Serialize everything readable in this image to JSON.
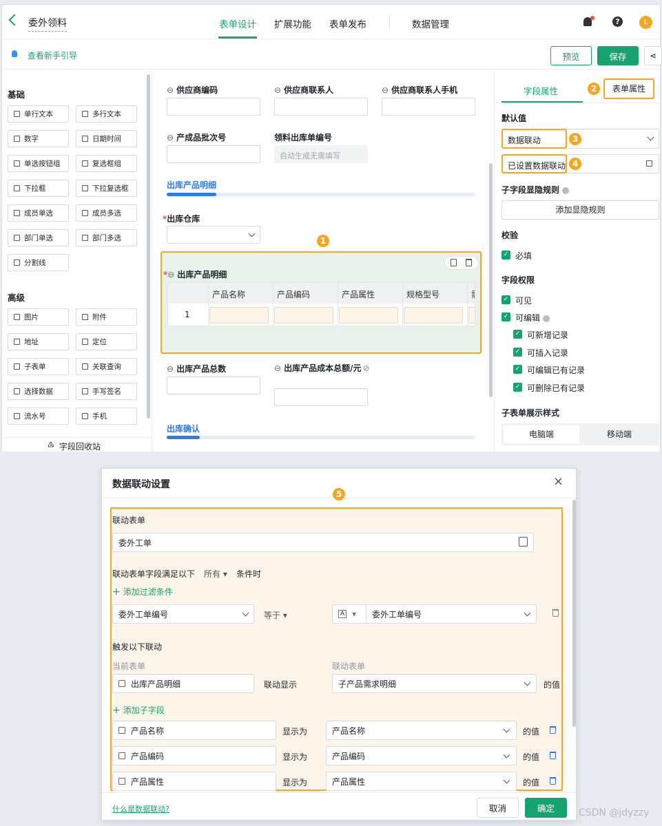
{
  "header": {
    "title": "委外领料",
    "tabs": [
      "表单设计",
      "扩展功能",
      "表单发布",
      "数据管理"
    ],
    "avatar": "L"
  },
  "subbar": {
    "guide": "查看新手引导",
    "preview": "预览",
    "save": "保存"
  },
  "left": {
    "basic_title": "基础",
    "basic": [
      "单行文本",
      "多行文本",
      "数字",
      "日期时间",
      "单选按钮组",
      "复选框组",
      "下拉框",
      "下拉复选框",
      "成员单选",
      "成员多选",
      "部门单选",
      "部门多选",
      "分割线"
    ],
    "advanced_title": "高级",
    "advanced": [
      "图片",
      "附件",
      "地址",
      "定位",
      "子表单",
      "关联查询",
      "选择数据",
      "手写签名",
      "流水号",
      "手机"
    ],
    "recycle": "字段回收站"
  },
  "center": {
    "f_supplier_code": "供应商编码",
    "f_supplier_contact": "供应商联系人",
    "f_supplier_phone": "供应商联系人手机",
    "f_batch": "产成品批次号",
    "f_order_no": "领料出库单编号",
    "f_order_no_placeholder": "自动生成无需填写",
    "section1": "出库产品明细",
    "warehouse": "出库仓库",
    "subtable_label": "出库产品明细",
    "columns": [
      "产品名称",
      "产品编码",
      "产品属性",
      "规格型号",
      "需"
    ],
    "row_no": "1",
    "f_total_qty": "出库产品总数",
    "f_total_cost": "出库产品成本总额/元",
    "section2": "出库确认"
  },
  "right": {
    "tab_field": "字段属性",
    "tab_form": "表单属性",
    "default_title": "默认值",
    "default_value": "数据联动",
    "linkage_set": "已设置数据联动",
    "visibility_title": "子字段显隐规则",
    "add_visibility": "添加显隐规则",
    "validation_title": "校验",
    "required": "必填",
    "perm_title": "字段权限",
    "visible": "可见",
    "editable": "可编辑",
    "perm_items": [
      "可新增记录",
      "可插入记录",
      "可编辑已有记录",
      "可删除已有记录"
    ],
    "style_title": "子表单展示样式",
    "pc": "电脑端",
    "mobile": "移动端"
  },
  "badges": [
    "1",
    "2",
    "3",
    "4",
    "5"
  ],
  "dialog": {
    "title": "数据联动设置",
    "linked_form_label": "联动表单",
    "linked_form": "委外工单",
    "condition_prefix": "联动表单字段满足以下",
    "condition_all": "所有",
    "condition_suffix": "条件时",
    "add_filter": "添加过滤条件",
    "filter_field": "委外工单编号",
    "filter_op": "等于",
    "filter_type": "A",
    "filter_value": "委外工单编号",
    "trigger_title": "触发以下联动",
    "current_form": "当前表单",
    "linked_form_col": "联动表单",
    "current_field": "出库产品明细",
    "show_link": "联动显示",
    "target_field": "子产品需求明细",
    "value_of": "的值",
    "add_sub": "添加子字段",
    "sub_rows": [
      {
        "left": "产品名称",
        "mid": "显示为",
        "right": "产品名称",
        "tail": "的值"
      },
      {
        "left": "产品编码",
        "mid": "显示为",
        "right": "产品编码",
        "tail": "的值"
      },
      {
        "left": "产品属性",
        "mid": "显示为",
        "right": "产品属性",
        "tail": "的值"
      }
    ],
    "help_link": "什么是数据联动?",
    "cancel": "取消",
    "ok": "确定"
  },
  "watermark": "CSDN @jdyzzy",
  "colors": {
    "brand": "#16a36f",
    "highlight": "#f5a623",
    "section_blue": "#2d7be5"
  }
}
